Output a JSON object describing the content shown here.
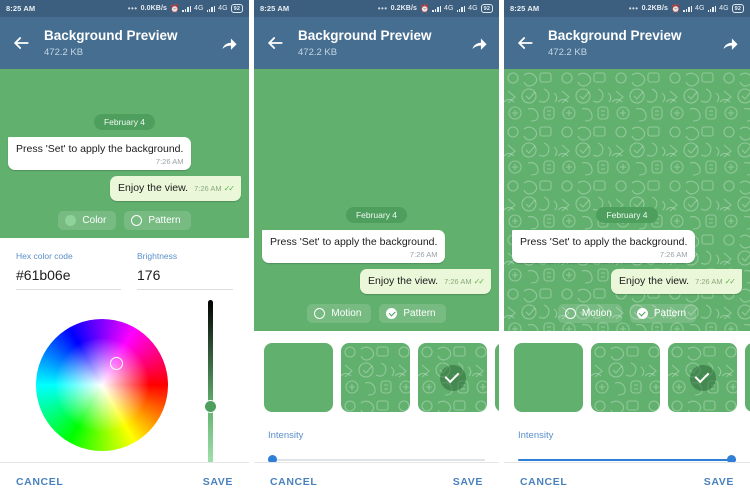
{
  "panels": [
    {
      "id": "color-picker",
      "status": {
        "time": "8:25 AM",
        "dots": "•••",
        "rate": "0.0KB/s",
        "alarm": "alarm-icon",
        "net1": "4G",
        "net2": "4G",
        "battery": "92"
      },
      "appbar": {
        "back": "back-arrow-icon",
        "title": "Background Preview",
        "subtitle": "472.2 KB",
        "share": "share-icon"
      },
      "chat": {
        "date_chip": "February 4",
        "incoming": {
          "text": "Press 'Set' to apply the background.",
          "time": "7:26 AM"
        },
        "outgoing": {
          "text": "Enjoy the view.",
          "time": "7:26 AM",
          "ticks": "✓✓"
        },
        "toggles": [
          {
            "label": "Color",
            "style": "filled",
            "selected": true
          },
          {
            "label": "Pattern",
            "style": "outline",
            "selected": false
          }
        ],
        "pattern_opacity": "off"
      },
      "editor": {
        "mode": "color",
        "hex_label": "Hex color code",
        "hex_value": "#61b06e",
        "brightness_label": "Brightness",
        "brightness_value": "176"
      },
      "actions": {
        "cancel": "CANCEL",
        "save": "SAVE"
      }
    },
    {
      "id": "pattern-none",
      "status": {
        "time": "8:25 AM",
        "dots": "•••",
        "rate": "0.2KB/s",
        "alarm": "alarm-icon",
        "net1": "4G",
        "net2": "4G",
        "battery": "92"
      },
      "appbar": {
        "back": "back-arrow-icon",
        "title": "Background Preview",
        "subtitle": "472.2 KB",
        "share": "share-icon"
      },
      "chat": {
        "date_chip": "February 4",
        "incoming": {
          "text": "Press 'Set' to apply the background.",
          "time": "7:26 AM"
        },
        "outgoing": {
          "text": "Enjoy the view.",
          "time": "7:26 AM",
          "ticks": "✓✓"
        },
        "toggles": [
          {
            "label": "Motion",
            "style": "outline",
            "selected": false
          },
          {
            "label": "Pattern",
            "style": "check",
            "selected": true
          }
        ],
        "pattern_opacity": "off"
      },
      "editor": {
        "mode": "pattern",
        "intensity_label": "Intensity",
        "intensity_value": "0",
        "thumbnails": [
          {
            "name": "pattern-solid",
            "pattern": false,
            "selected": false
          },
          {
            "name": "pattern-doodles",
            "pattern": true,
            "selected": false
          },
          {
            "name": "pattern-doodles-selected",
            "pattern": true,
            "selected": true
          },
          {
            "name": "pattern-next",
            "pattern": false,
            "selected": false
          }
        ]
      },
      "actions": {
        "cancel": "CANCEL",
        "save": "SAVE"
      }
    },
    {
      "id": "pattern-full",
      "status": {
        "time": "8:25 AM",
        "dots": "•••",
        "rate": "0.2KB/s",
        "alarm": "alarm-icon",
        "net1": "4G",
        "net2": "4G",
        "battery": "92"
      },
      "appbar": {
        "back": "back-arrow-icon",
        "title": "Background Preview",
        "subtitle": "472.2 KB",
        "share": "share-icon"
      },
      "chat": {
        "date_chip": "February 4",
        "incoming": {
          "text": "Press 'Set' to apply the background.",
          "time": "7:26 AM"
        },
        "outgoing": {
          "text": "Enjoy the view.",
          "time": "7:26 AM",
          "ticks": "✓✓"
        },
        "toggles": [
          {
            "label": "Motion",
            "style": "outline",
            "selected": false
          },
          {
            "label": "Pattern",
            "style": "check",
            "selected": true
          }
        ],
        "pattern_opacity": "on"
      },
      "editor": {
        "mode": "pattern",
        "intensity_label": "Intensity",
        "intensity_value": "100",
        "thumbnails": [
          {
            "name": "pattern-solid",
            "pattern": false,
            "selected": false
          },
          {
            "name": "pattern-doodles",
            "pattern": true,
            "selected": false
          },
          {
            "name": "pattern-doodles-selected",
            "pattern": true,
            "selected": true
          },
          {
            "name": "pattern-next",
            "pattern": false,
            "selected": false
          }
        ]
      },
      "actions": {
        "cancel": "CANCEL",
        "save": "SAVE"
      }
    }
  ],
  "colors": {
    "appbar": "#456e91",
    "statusbar": "#3c5f7f",
    "chat_green": "#61b06e",
    "accent_blue": "#4a82bd",
    "slider_blue": "#2f7ed8",
    "outgoing_bubble": "#eaf7d8"
  }
}
